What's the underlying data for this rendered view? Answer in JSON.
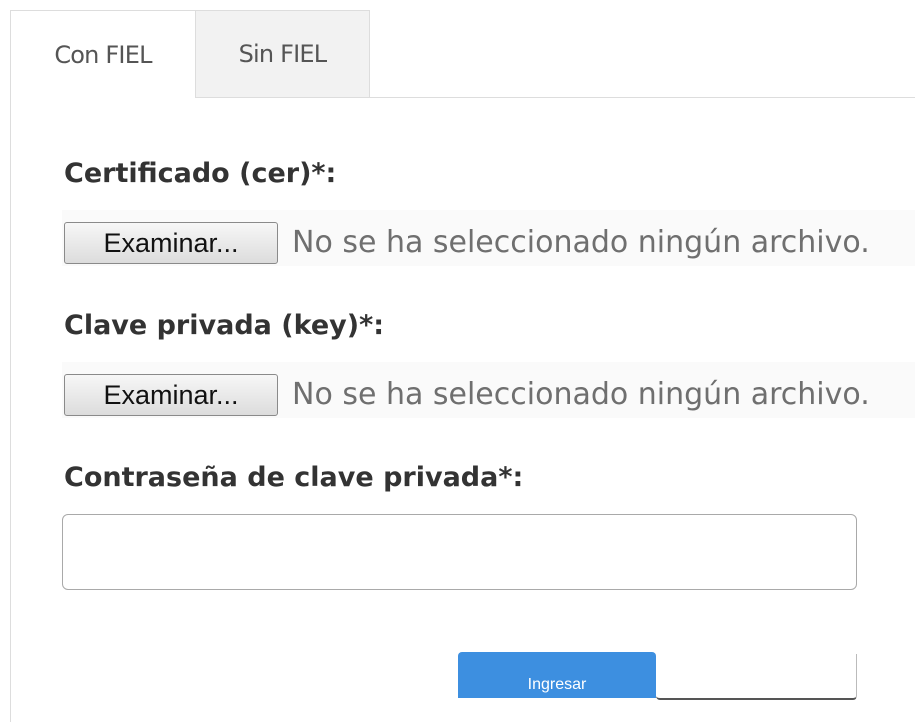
{
  "tabs": [
    {
      "label": "Con FIEL",
      "active": true
    },
    {
      "label": "Sin FIEL",
      "active": false
    }
  ],
  "form": {
    "certificate": {
      "label": "Certificado (cer)*:",
      "button_label": "Examinar...",
      "status": "No se ha seleccionado ningún archivo."
    },
    "private_key": {
      "label": "Clave privada (key)*:",
      "button_label": "Examinar...",
      "status": "No se ha seleccionado ningún archivo."
    },
    "password": {
      "label": "Contraseña de clave privada*:",
      "value": "",
      "placeholder": ""
    }
  },
  "actions": {
    "submit_label": "Ingresar"
  },
  "colors": {
    "primary_button": "#3d8fe0",
    "label_text": "#333333",
    "border": "#dddddd"
  }
}
